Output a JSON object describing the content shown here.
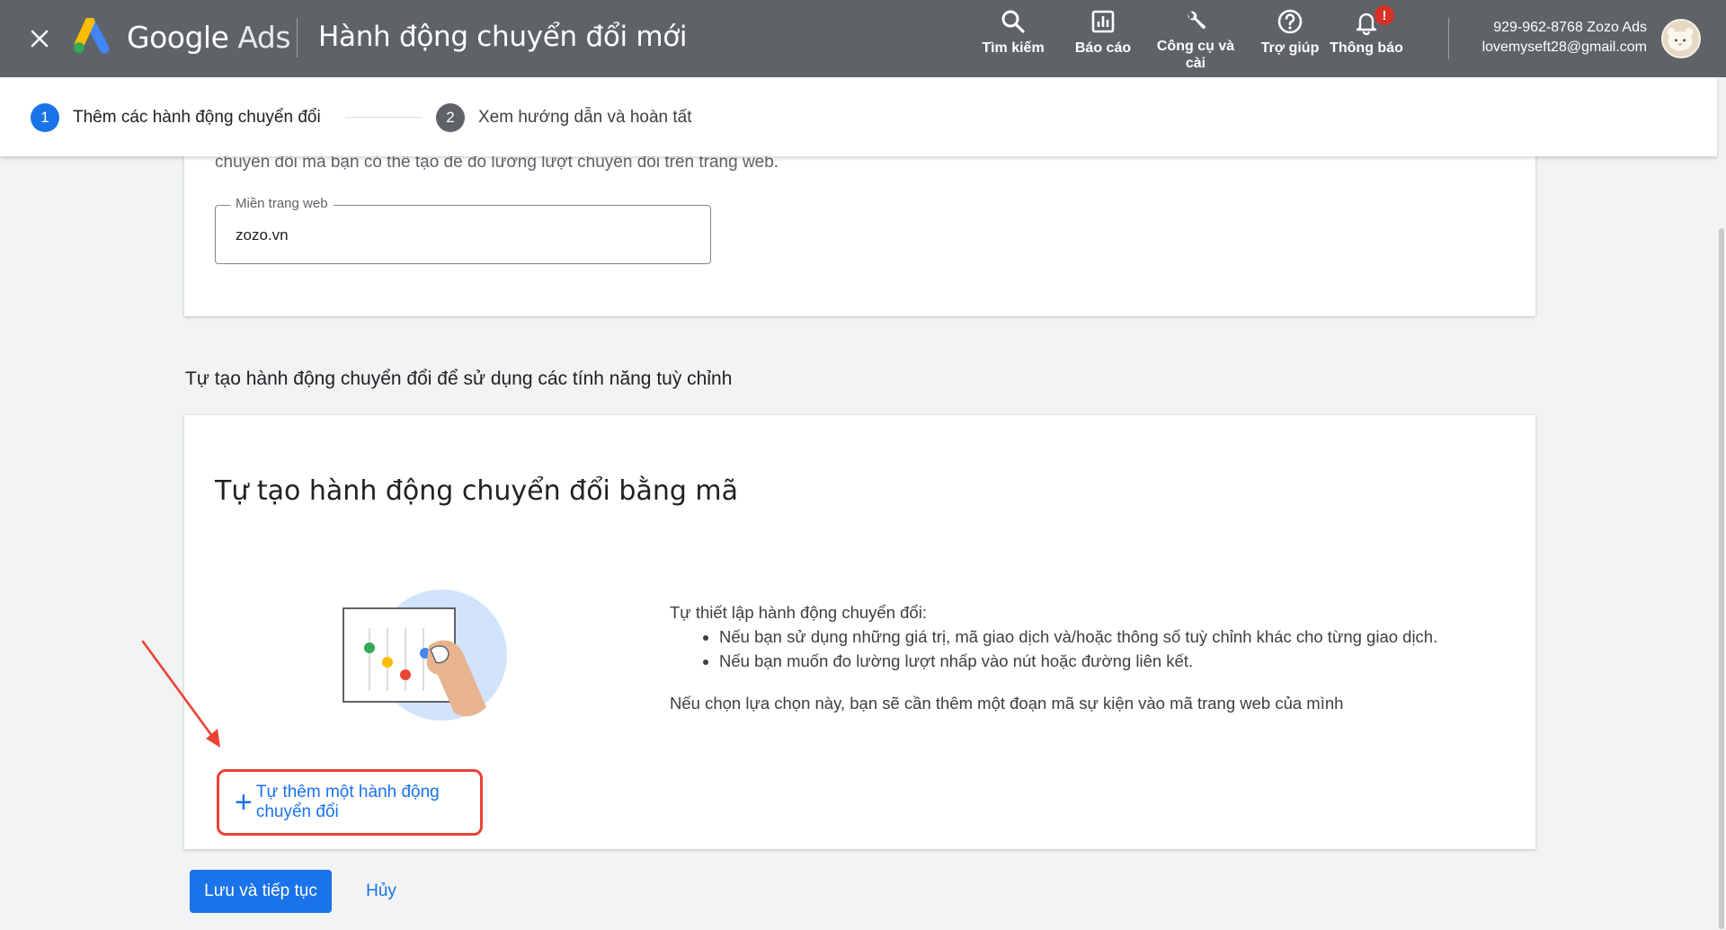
{
  "header": {
    "brand_main": "Google",
    "brand_sub": "Ads",
    "title": "Hành động chuyển đổi mới",
    "nav": [
      {
        "label": "Tìm kiếm",
        "icon": "search-icon"
      },
      {
        "label": "Báo cáo",
        "icon": "reports-icon"
      },
      {
        "label": "Công cụ và cài",
        "icon": "wrench-icon"
      },
      {
        "label": "Trợ giúp",
        "icon": "help-icon"
      },
      {
        "label": "Thông báo",
        "icon": "bell-icon"
      }
    ],
    "notif_badge": "!",
    "account_id": "929-962-8768 Zozo Ads",
    "account_email": "lovemyseft28@gmail.com"
  },
  "stepper": {
    "steps": [
      {
        "num": "1",
        "label": "Thêm các hành động chuyển đổi"
      },
      {
        "num": "2",
        "label": "Xem hướng dẫn và hoàn tất"
      }
    ]
  },
  "top_card": {
    "cut_text": "chuyển đổi mà bạn có thể tạo để đo lường lượt chuyển đổi trên trang web.",
    "field_label": "Miền trang web",
    "field_value": "zozo.vn"
  },
  "section_title": "Tự tạo hành động chuyển đổi để sử dụng các tính năng tuỳ chỉnh",
  "main_card": {
    "heading": "Tự tạo hành động chuyển đổi bằng mã",
    "intro": "Tự thiết lập hành động chuyển đổi:",
    "bullets": [
      "Nếu bạn sử dụng những giá trị, mã giao dịch và/hoặc thông số tuỳ chỉnh khác cho từng giao dịch.",
      "Nếu bạn muốn đo lường lượt nhấp vào nút hoặc đường liên kết."
    ],
    "note": "Nếu chọn lựa chọn này, bạn sẽ cần thêm một đoạn mã sự kiện vào mã trang web của mình",
    "add_button": "Tự thêm một hành động chuyển đổi"
  },
  "footer": {
    "save": "Lưu và tiếp tục",
    "cancel": "Hủy"
  },
  "colors": {
    "header_bg": "#5f6368",
    "accent": "#1a73e8",
    "highlight": "#e94235",
    "badge": "#d93025"
  }
}
